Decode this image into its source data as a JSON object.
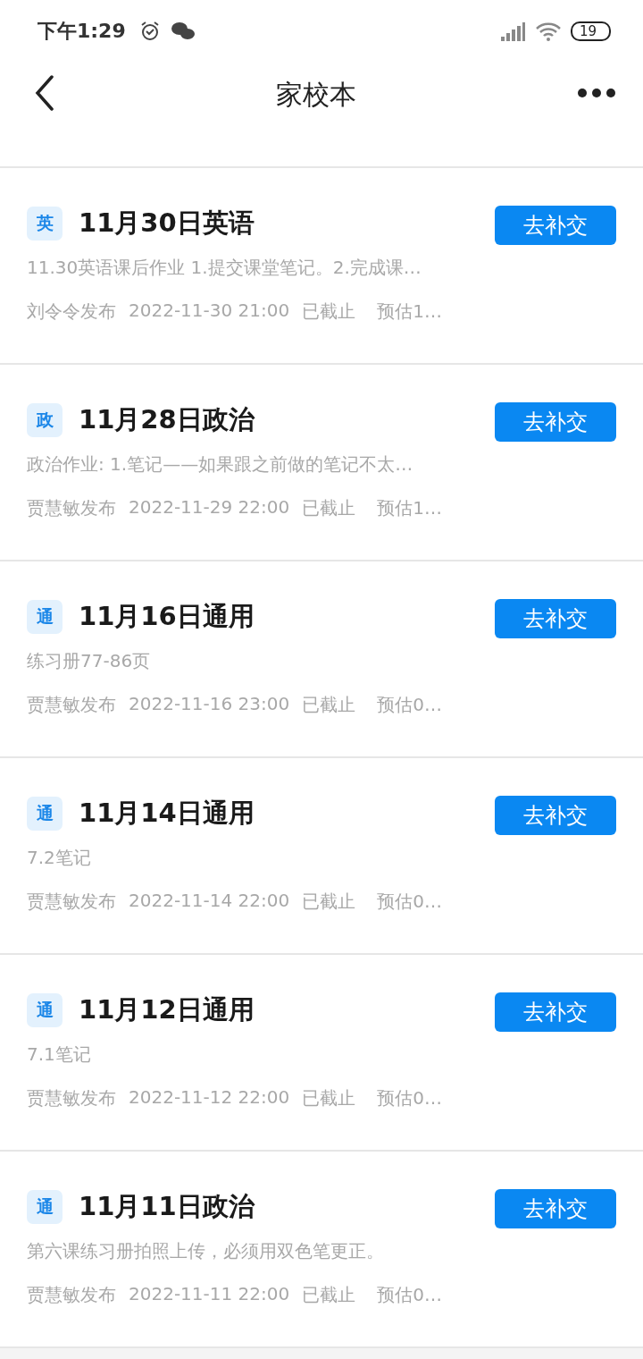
{
  "status_bar": {
    "time": "下午1:29",
    "battery": "19"
  },
  "nav": {
    "title": "家校本"
  },
  "assignments": [
    {
      "subject": "英",
      "title": "11月30日英语",
      "description": "11.30英语课后作业 1.提交课堂笔记。2.完成课…",
      "publisher": "刘令令发布",
      "deadline": "2022-11-30 21:00",
      "state": "已截止",
      "estimate": "预估1…",
      "action": "去补交"
    },
    {
      "subject": "政",
      "title": "11月28日政治",
      "description": "政治作业: 1.笔记——如果跟之前做的笔记不太…",
      "publisher": "贾慧敏发布",
      "deadline": "2022-11-29 22:00",
      "state": "已截止",
      "estimate": "预估1…",
      "action": "去补交"
    },
    {
      "subject": "通",
      "title": "11月16日通用",
      "description": "练习册77-86页",
      "publisher": "贾慧敏发布",
      "deadline": "2022-11-16 23:00",
      "state": "已截止",
      "estimate": "预估0…",
      "action": "去补交"
    },
    {
      "subject": "通",
      "title": "11月14日通用",
      "description": "7.2笔记",
      "publisher": "贾慧敏发布",
      "deadline": "2022-11-14 22:00",
      "state": "已截止",
      "estimate": "预估0…",
      "action": "去补交"
    },
    {
      "subject": "通",
      "title": "11月12日通用",
      "description": "7.1笔记",
      "publisher": "贾慧敏发布",
      "deadline": "2022-11-12 22:00",
      "state": "已截止",
      "estimate": "预估0…",
      "action": "去补交"
    },
    {
      "subject": "通",
      "title": "11月11日政治",
      "description": "第六课练习册拍照上传，必须用双色笔更正。",
      "publisher": "贾慧敏发布",
      "deadline": "2022-11-11 22:00",
      "state": "已截止",
      "estimate": "预估0…",
      "action": "去补交"
    }
  ]
}
